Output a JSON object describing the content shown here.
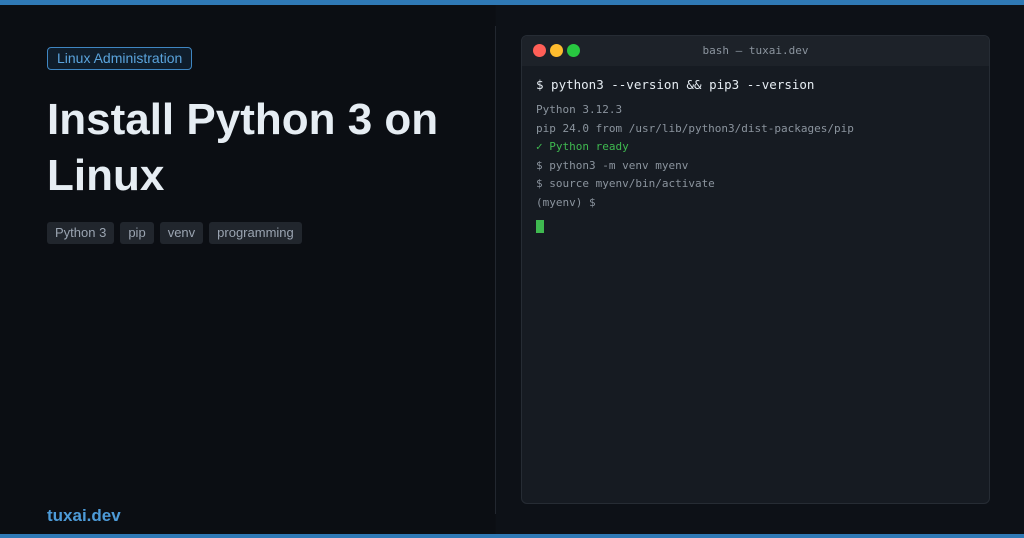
{
  "colors": {
    "accent": "#2f79b5",
    "brand": "#4d9bd8",
    "success": "#3fb950",
    "cursor": "#3fb950",
    "dot_red": "#ff5f57",
    "dot_yellow": "#febc2e",
    "dot_green": "#28c840"
  },
  "article": {
    "category": "Linux Administration",
    "title": "Install Python 3 on Linux",
    "tags": [
      "Python 3",
      "pip",
      "venv",
      "programming"
    ]
  },
  "brand": {
    "name": "tuxai.dev"
  },
  "terminal": {
    "title": "bash — tuxai.dev",
    "window_controls": [
      "close-dot",
      "minimize-dot",
      "maximize-dot"
    ],
    "command": "$ python3 --version && pip3 --version",
    "output": {
      "python_version": "Python 3.12.3",
      "pip_version": "pip 24.0 from /usr/lib/python3/dist-packages/pip",
      "status": "✓ Python ready",
      "venv_command": "$ python3 -m venv myenv",
      "activate_command": "$ source myenv/bin/activate",
      "prompt": "(myenv) $"
    }
  }
}
